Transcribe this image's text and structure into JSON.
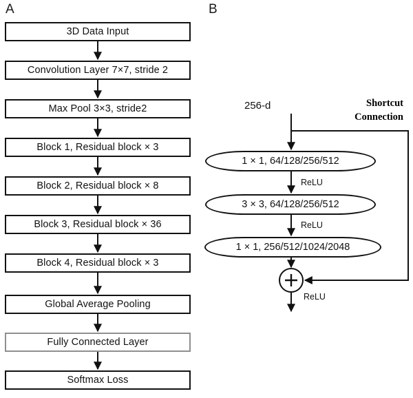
{
  "figure": {
    "panels": [
      {
        "id": "A",
        "label": "A"
      },
      {
        "id": "B",
        "label": "B"
      }
    ]
  },
  "panel_a": {
    "label": "A",
    "boxes": [
      {
        "label": "3D Data Input",
        "style": "solid"
      },
      {
        "label": "Convolution Layer 7×7,  stride 2",
        "style": "solid"
      },
      {
        "label": "Max Pool 3×3,  stride2",
        "style": "solid"
      },
      {
        "label": "Block 1, Residual block × 3",
        "style": "solid"
      },
      {
        "label": "Block 2, Residual block × 8",
        "style": "solid"
      },
      {
        "label": "Block 3, Residual block × 36",
        "style": "solid"
      },
      {
        "label": "Block 4, Residual block × 3",
        "style": "solid"
      },
      {
        "label": "Global Average Pooling",
        "style": "solid"
      },
      {
        "label": "Fully Connected Layer",
        "style": "muted"
      },
      {
        "label": "Softmax Loss",
        "style": "solid"
      }
    ]
  },
  "panel_b": {
    "label": "B",
    "input_label": "256-d",
    "shortcut_label_line1": "Shortcut",
    "shortcut_label_line2": "Connection",
    "pills": [
      {
        "label": "1 × 1,   64/128/256/512"
      },
      {
        "label": "3 × 3,   64/128/256/512"
      },
      {
        "label": "1 × 1,   256/512/1024/2048"
      }
    ],
    "edge_labels": [
      "ReLU",
      "ReLU",
      "ReLU"
    ],
    "adder_symbol": "+"
  },
  "colors": {
    "stroke": "#111111",
    "muted_stroke": "#8f8f8f",
    "background": "#ffffff",
    "text": "#111111"
  }
}
